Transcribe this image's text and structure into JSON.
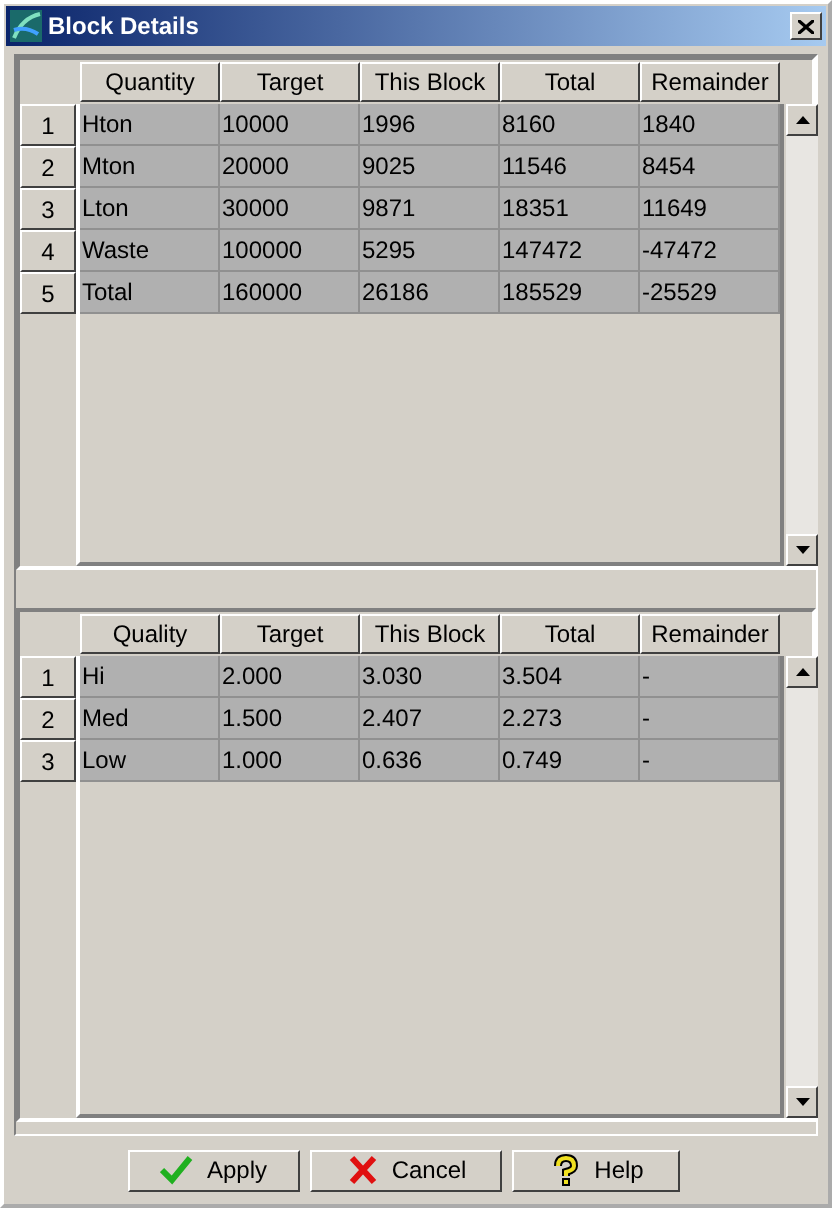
{
  "window": {
    "title": "Block Details"
  },
  "quantity_table": {
    "columns": [
      "Quantity",
      "Target",
      "This Block",
      "Total",
      "Remainder"
    ],
    "rows": [
      {
        "number": "1",
        "cells": [
          "Hton",
          "10000",
          "1996",
          "8160",
          "1840"
        ]
      },
      {
        "number": "2",
        "cells": [
          "Mton",
          "20000",
          "9025",
          "11546",
          "8454"
        ]
      },
      {
        "number": "3",
        "cells": [
          "Lton",
          "30000",
          "9871",
          "18351",
          "11649"
        ]
      },
      {
        "number": "4",
        "cells": [
          "Waste",
          "100000",
          "5295",
          "147472",
          "-47472"
        ]
      },
      {
        "number": "5",
        "cells": [
          "Total",
          "160000",
          "26186",
          "185529",
          "-25529"
        ]
      }
    ]
  },
  "quality_table": {
    "columns": [
      "Quality",
      "Target",
      "This Block",
      "Total",
      "Remainder"
    ],
    "rows": [
      {
        "number": "1",
        "cells": [
          "Hi",
          "2.000",
          "3.030",
          "3.504",
          "-"
        ]
      },
      {
        "number": "2",
        "cells": [
          "Med",
          "1.500",
          "2.407",
          "2.273",
          "-"
        ]
      },
      {
        "number": "3",
        "cells": [
          "Low",
          "1.000",
          "0.636",
          "0.749",
          "-"
        ]
      }
    ]
  },
  "buttons": [
    {
      "label": "Apply",
      "kind": "apply"
    },
    {
      "label": "Cancel",
      "kind": "cancel"
    },
    {
      "label": "Help",
      "kind": "help"
    }
  ]
}
